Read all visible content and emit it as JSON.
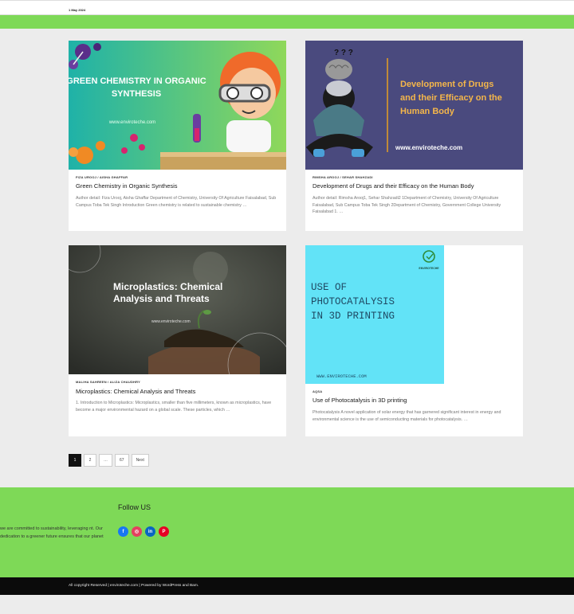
{
  "header": {
    "date": "1 May 2024"
  },
  "posts": [
    {
      "image_text": "GREEN CHEMISTRY IN ORGANIC SYNTHESIS",
      "image_url_text": "www.enviroteche.com",
      "authors": "FIZA UROOJ / AISHA GHAFFAR",
      "title": "Green Chemistry in Organic Synthesis",
      "excerpt": "Author detail: Fiza Urooj, Aisha Ghaffar Department of Chemistry, University Of Agriculture Faisalabad, Sub Campus Toba Tek Singh Introduction Green chemistry is related to sustainable chemistry …"
    },
    {
      "image_text": "Development of Drugs and their Efficacy on the Human Body",
      "image_url_text": "www.enviroteche.com",
      "authors": "RIMSHA AROOJ / SEHAR SHAHZADI",
      "title": "Development of Drugs and their Efficacy on the Human Body",
      "excerpt": "Author detail: Rimsha Arooj1, Sehar Shahzadi2 1Department of Chemistry, University Of Agriculture Faisalabad, Sub Campus Toba Tek Singh 2Department of Chemistry, Government College University Faisalabad 1. …"
    },
    {
      "image_text": "Microplastics: Chemical Analysis and Threats",
      "image_url_text": "www.enviroteche.com",
      "authors": "MALIHA SAHREEN / ALIZA CHAUDHRY",
      "title": "Microplastics: Chemical Analysis and Threats",
      "excerpt": "1. Introduction to Microplastics: Microplastics, smaller than five millimeters, known as microplastics, have become a major environmental hazard on a global scale. These particles, which …"
    },
    {
      "image_text": "USE OF PHOTOCATALYSIS IN 3D PRINTING",
      "image_url_text": "WWW.ENVIROTECHE.COM",
      "image_logo_text": "ENVIROTECHE",
      "authors": "AQSA",
      "title": "Use of Photocatalysis in 3D printing",
      "excerpt": "Photocatalysis A novel application of solar energy that has garnered significant interest in energy and environmental science is the use of semiconducting materials for photocatalysis. …"
    }
  ],
  "pagination": {
    "page1": "1",
    "page2": "2",
    "ellipsis": "…",
    "last": "67",
    "next": "Next"
  },
  "footer": {
    "about": "we are committed to sustainability, leveraging nt. Our dedication to a greener future ensures that our planet",
    "follow_title": "Follow US",
    "socials": [
      {
        "icon": "facebook-icon",
        "glyph": "f",
        "color": "#1877f2"
      },
      {
        "icon": "instagram-icon",
        "glyph": "◎",
        "color": "#e4405f"
      },
      {
        "icon": "linkedin-icon",
        "glyph": "in",
        "color": "#0a66c2"
      },
      {
        "icon": "pinterest-icon",
        "glyph": "P",
        "color": "#e60023"
      }
    ]
  },
  "copyright": "All copyright Reserved | enviroteche.com | Powered by WordPress and Bam.",
  "colors": {
    "accent_green": "#7ed957",
    "dark": "#0b0b0b"
  }
}
